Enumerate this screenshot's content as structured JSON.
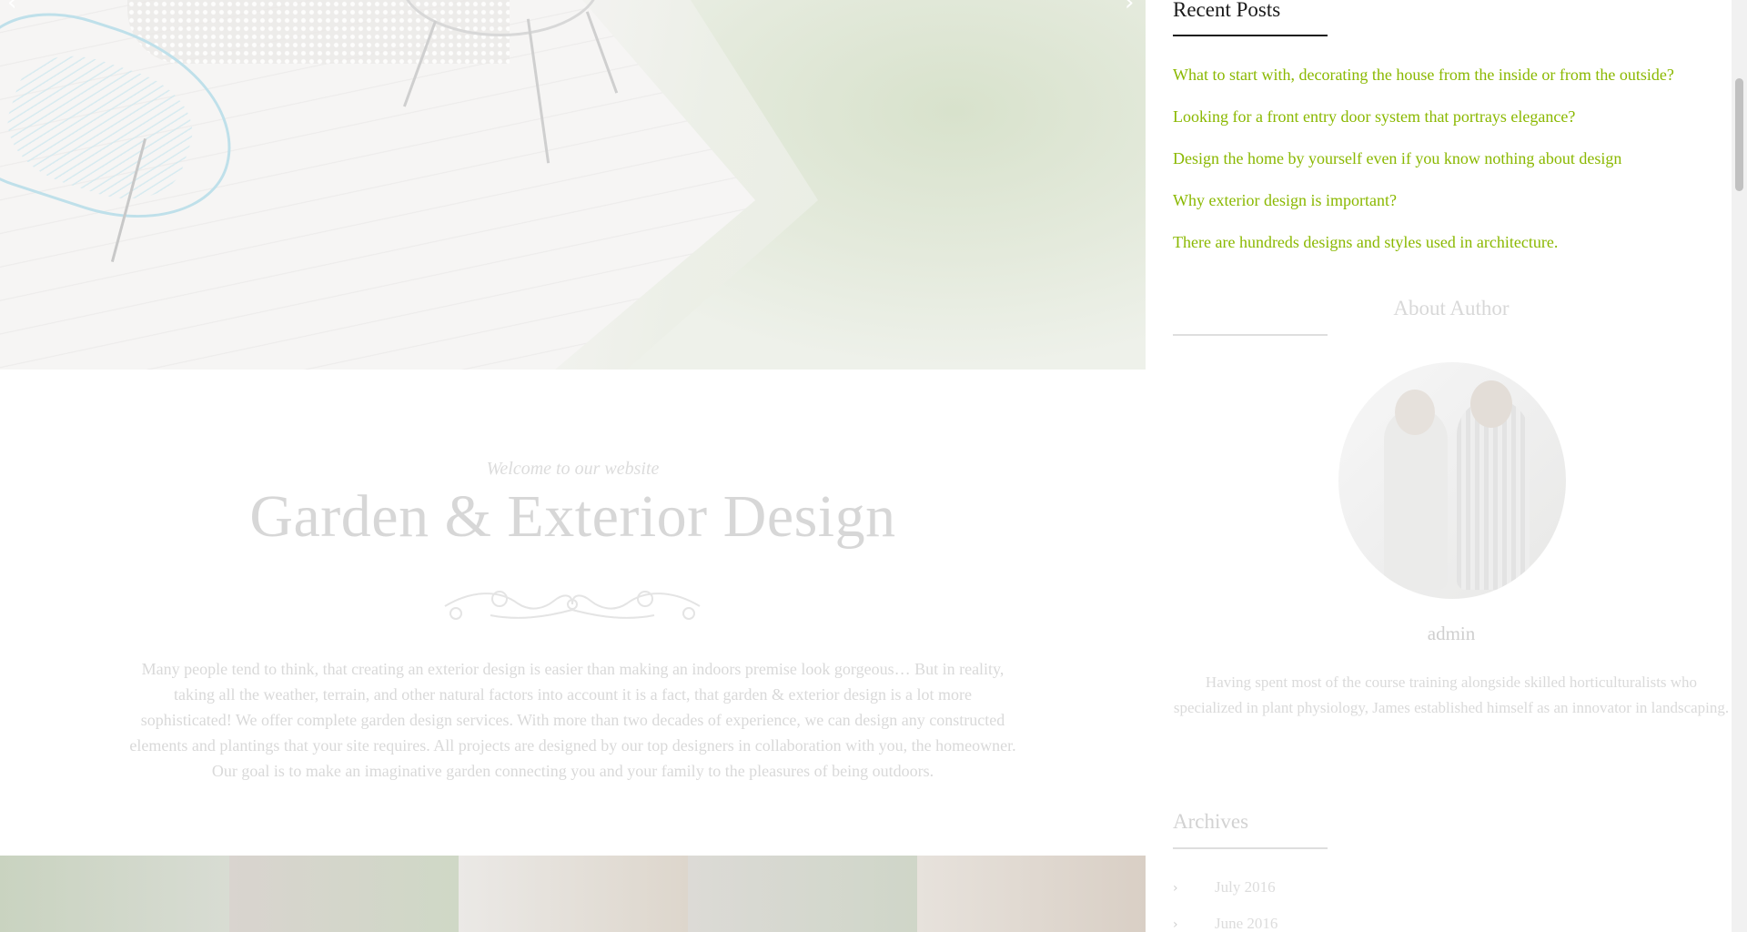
{
  "hero": {
    "prev_arrow": "‹",
    "next_arrow": "›"
  },
  "intro": {
    "subtitle": "Welcome to our website",
    "title": "Garden & Exterior Design",
    "text": "Many people tend to think, that creating an exterior design is easier than making an indoors premise look gorgeous… But in reality, taking all the weather, terrain, and other natural factors into account it is a fact, that garden & exterior design is a lot more sophisticated! We offer complete garden design services. With more than two decades of experience, we can design any constructed elements and plantings that your site requires. All projects are designed by our top designers in collaboration with you, the homeowner. Our goal is to make an imaginative garden connecting you and your family to the pleasures of being outdoors."
  },
  "sidebar": {
    "recent_posts": {
      "title": "Recent Posts",
      "items": [
        "What to start with, decorating the house from the inside or from the outside?",
        "Looking for a front entry door system that portrays elegance?",
        "Design the home by yourself even if you know nothing about design",
        "Why exterior design is important?",
        "There are hundreds designs and styles used in architecture."
      ]
    },
    "about": {
      "title": "About Author",
      "name": "admin",
      "bio": "Having spent most of the course training alongside skilled horticulturalists who specialized in plant physiology, James established himself as an innovator in landscaping."
    },
    "archives": {
      "title": "Archives",
      "items": [
        "July 2016",
        "June 2016"
      ]
    }
  },
  "colors": {
    "link": "#8ab800",
    "heading": "#1a1a1a",
    "faded_text": "#d9d9d9"
  }
}
